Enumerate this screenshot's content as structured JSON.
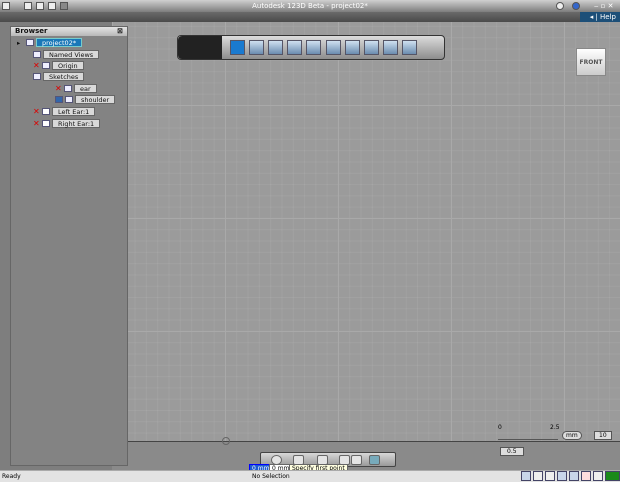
{
  "window": {
    "title": "Autodesk 123D Beta - project02*"
  },
  "menu": {
    "help": "◂ | Help"
  },
  "browser": {
    "title": "Browser",
    "nodes": [
      {
        "label": "project02*",
        "hidden": false,
        "selected": true
      },
      {
        "label": "Named Views",
        "hidden": false
      },
      {
        "label": "Origin",
        "hidden": true
      },
      {
        "label": "Sketches",
        "hidden": false
      },
      {
        "label": "ear",
        "hidden": true
      },
      {
        "label": "shoulder",
        "hidden": false
      },
      {
        "label": "Left Ear:1",
        "hidden": true
      },
      {
        "label": "Right Ear:1",
        "hidden": true
      }
    ]
  },
  "viewcube": {
    "face": "FRONT"
  },
  "ruler": {
    "tick0": "0",
    "tick1": "2.5",
    "unit": "mm",
    "scale_value": "10",
    "pointer_value": "0.5"
  },
  "prompt": {
    "x_value": "0 mm",
    "y_value": "0 mm",
    "tooltip": "Specify first point"
  },
  "status": {
    "left": "Ready",
    "selection": "No Selection"
  },
  "colors": {
    "selection": "#1a78b8",
    "help_bg": "#1d4f78"
  }
}
